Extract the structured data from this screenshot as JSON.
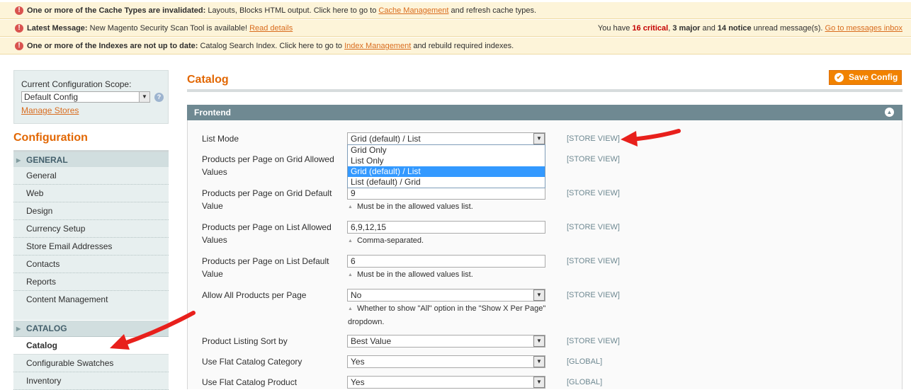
{
  "messages": {
    "cache": {
      "bold": "One or more of the Cache Types are invalidated:",
      "text": " Layouts, Blocks HTML output. Click here to go to ",
      "link": "Cache Management",
      "tail": " and refresh cache types."
    },
    "latest": {
      "bold": "Latest Message:",
      "text": " New Magento Security Scan Tool is available! ",
      "link": "Read details",
      "right_prefix": "You have ",
      "critical": "16 critical",
      "sep1": ", ",
      "major": "3 major",
      "sep2": " and ",
      "notice": "14 notice",
      "right_suffix": " unread message(s). ",
      "inbox_link": "Go to messages inbox"
    },
    "index": {
      "bold": "One or more of the Indexes are not up to date:",
      "text": " Catalog Search Index. Click here to go to ",
      "link": "Index Management",
      "tail": " and rebuild required indexes."
    }
  },
  "scope": {
    "label": "Current Configuration Scope:",
    "value": "Default Config",
    "manage_link": "Manage Stores"
  },
  "sidebar": {
    "title": "Configuration",
    "general": {
      "heading": "GENERAL",
      "items": [
        "General",
        "Web",
        "Design",
        "Currency Setup",
        "Store Email Addresses",
        "Contacts",
        "Reports",
        "Content Management"
      ]
    },
    "catalog": {
      "heading": "CATALOG",
      "items": [
        "Catalog",
        "Configurable Swatches",
        "Inventory"
      ],
      "active": "Catalog"
    }
  },
  "main": {
    "title": "Catalog",
    "save_label": "Save Config",
    "fieldset": "Frontend",
    "fields": {
      "list_mode": {
        "label": "List Mode",
        "value": "Grid (default) / List",
        "scope": "[STORE VIEW]"
      },
      "grid_allowed": {
        "label": "Products per Page on Grid Allowed Values",
        "scope": "[STORE VIEW]"
      },
      "grid_default": {
        "label": "Products per Page on Grid Default Value",
        "value": "9",
        "note": "Must be in the allowed values list.",
        "scope": "[STORE VIEW]"
      },
      "list_allowed": {
        "label": "Products per Page on List Allowed Values",
        "value": "6,9,12,15",
        "note": "Comma-separated.",
        "scope": "[STORE VIEW]"
      },
      "list_default": {
        "label": "Products per Page on List Default Value",
        "value": "6",
        "note": "Must be in the allowed values list.",
        "scope": "[STORE VIEW]"
      },
      "allow_all": {
        "label": "Allow All Products per Page",
        "value": "No",
        "note": "Whether to show \"All\" option in the \"Show X Per Page\" dropdown.",
        "scope": "[STORE VIEW]"
      },
      "sort_by": {
        "label": "Product Listing Sort by",
        "value": "Best Value",
        "scope": "[STORE VIEW]"
      },
      "flat_category": {
        "label": "Use Flat Catalog Category",
        "value": "Yes",
        "scope": "[GLOBAL]"
      },
      "flat_product": {
        "label": "Use Flat Catalog Product",
        "value": "Yes",
        "scope": "[GLOBAL]"
      }
    },
    "list_mode_options": [
      "Grid Only",
      "List Only",
      "Grid (default) / List",
      "List (default) / Grid"
    ],
    "list_mode_selected": "Grid (default) / List"
  },
  "colors": {
    "accent_orange": "#e26703",
    "save_button": "#f18200",
    "fieldset_header": "#6f8992",
    "annotation_arrow": "#e8201c"
  }
}
